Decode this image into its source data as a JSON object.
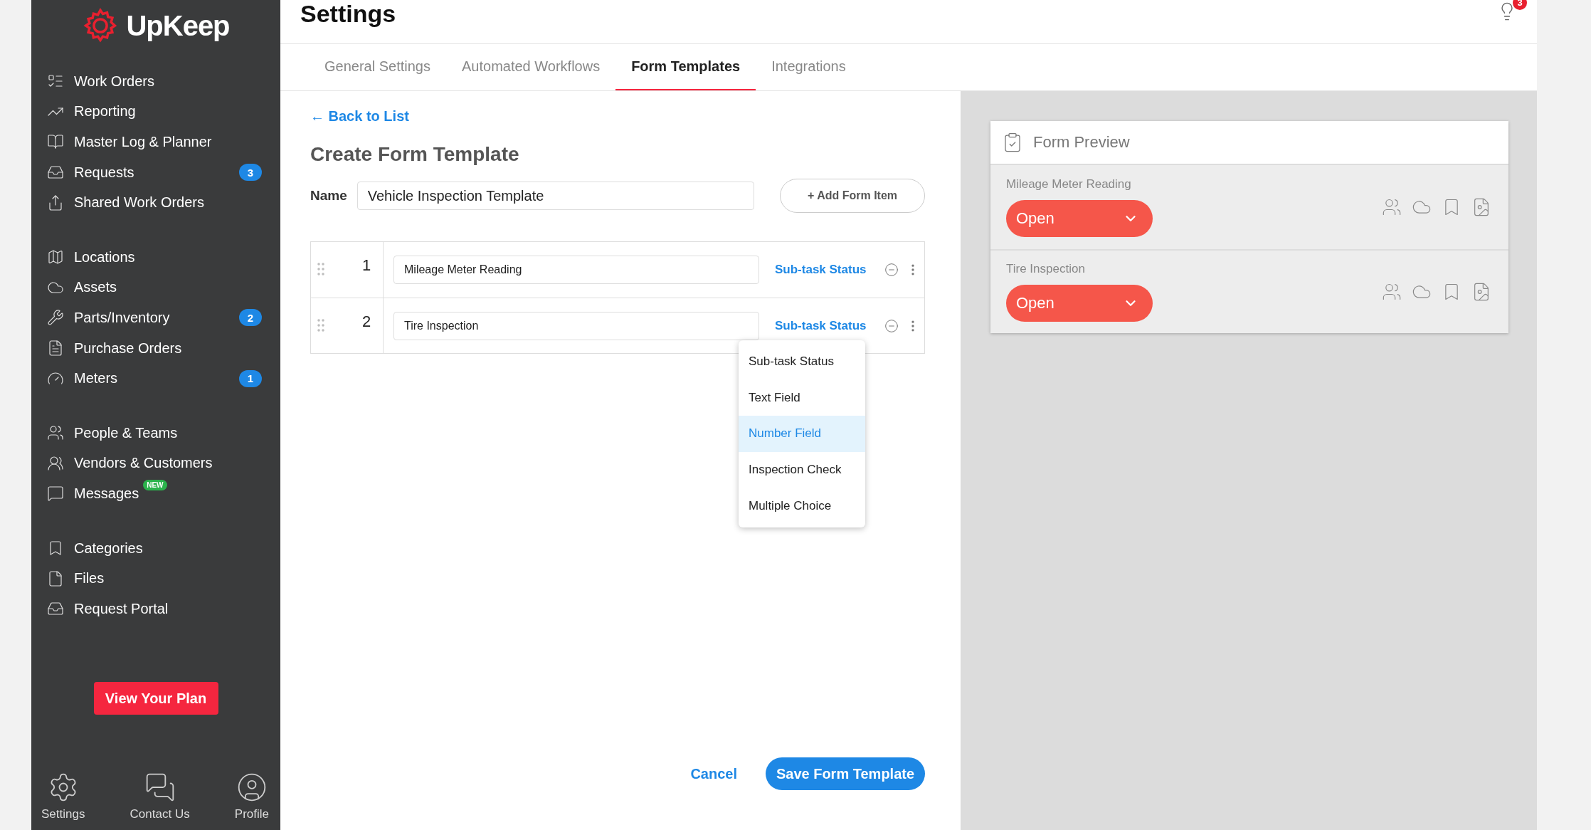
{
  "logo": {
    "text": "UpKeep"
  },
  "sidebar": {
    "groups": [
      [
        {
          "label": "Work Orders"
        },
        {
          "label": "Reporting"
        },
        {
          "label": "Master Log & Planner"
        },
        {
          "label": "Requests",
          "badge": "3"
        },
        {
          "label": "Shared Work Orders"
        }
      ],
      [
        {
          "label": "Locations"
        },
        {
          "label": "Assets"
        },
        {
          "label": "Parts/Inventory",
          "badge": "2"
        },
        {
          "label": "Purchase Orders"
        },
        {
          "label": "Meters",
          "badge": "1"
        }
      ],
      [
        {
          "label": "People & Teams"
        },
        {
          "label": "Vendors & Customers"
        },
        {
          "label": "Messages",
          "tag": "NEW"
        }
      ],
      [
        {
          "label": "Categories"
        },
        {
          "label": "Files"
        },
        {
          "label": "Request Portal"
        }
      ]
    ],
    "plan_button": "View Your Plan",
    "bottom_nav": [
      {
        "label": "Settings"
      },
      {
        "label": "Contact Us"
      },
      {
        "label": "Profile"
      }
    ]
  },
  "header": {
    "title": "Settings",
    "notification_count": "3"
  },
  "tabs": [
    {
      "label": "General Settings",
      "selected": false
    },
    {
      "label": "Automated Workflows",
      "selected": false
    },
    {
      "label": "Form Templates",
      "selected": true
    },
    {
      "label": "Integrations",
      "selected": false
    }
  ],
  "form": {
    "back_link": "← Back to List",
    "title": "Create Form Template",
    "name_label": "Name",
    "name_value": "Vehicle Inspection Template",
    "add_button": "+ Add Form Item",
    "items": [
      {
        "number": "1",
        "value": "Mileage Meter Reading",
        "type": "Sub-task Status"
      },
      {
        "number": "2",
        "value": "Tire Inspection",
        "type": "Sub-task Status"
      }
    ],
    "type_menu": [
      {
        "label": "Sub-task Status",
        "selected": false
      },
      {
        "label": "Text Field",
        "selected": false
      },
      {
        "label": "Number Field",
        "selected": true
      },
      {
        "label": "Inspection Check",
        "selected": false
      },
      {
        "label": "Multiple Choice",
        "selected": false
      }
    ],
    "cancel": "Cancel",
    "save": "Save Form Template"
  },
  "preview": {
    "title": "Form Preview",
    "items": [
      {
        "label": "Mileage Meter Reading",
        "status": "Open"
      },
      {
        "label": "Tire Inspection",
        "status": "Open"
      }
    ]
  }
}
